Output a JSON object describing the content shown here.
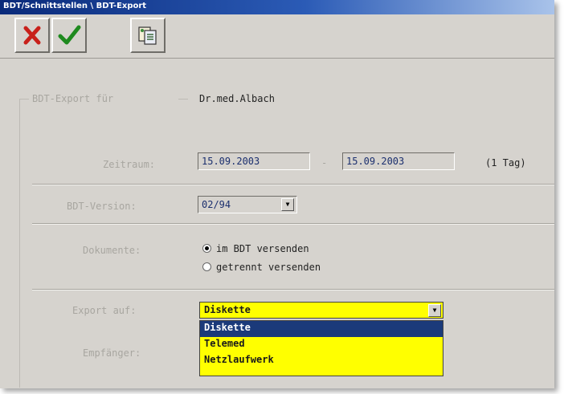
{
  "window": {
    "title": "BDT/Schnittstellen \\ BDT-Export"
  },
  "toolbar": {
    "cancel_icon": "x-icon",
    "ok_icon": "checkmark-icon",
    "third_icon": "export-document-icon",
    "colors": {
      "cancel": "#c8201a",
      "ok": "#1f8a1f"
    }
  },
  "form": {
    "export_for_label": "BDT-Export für",
    "export_for_value": "Dr.med.Albach",
    "period_label": "Zeitraum:",
    "date_from": "15.09.2003",
    "date_sep": "-",
    "date_to": "15.09.2003",
    "duration": "(1 Tag)",
    "version_label": "BDT-Version:",
    "version_value": "02/94",
    "documents_label": "Dokumente:",
    "documents_options": [
      "im BDT versenden",
      "getrennt versenden"
    ],
    "documents_selected": 0,
    "export_label": "Export auf:",
    "export_value": "Diskette",
    "export_options": [
      "Diskette",
      "Telemed",
      "Netzlaufwerk"
    ],
    "recipient_label": "Empfänger:",
    "highlight_color": "#ffff00",
    "selection_color": "#1b3a7a"
  }
}
